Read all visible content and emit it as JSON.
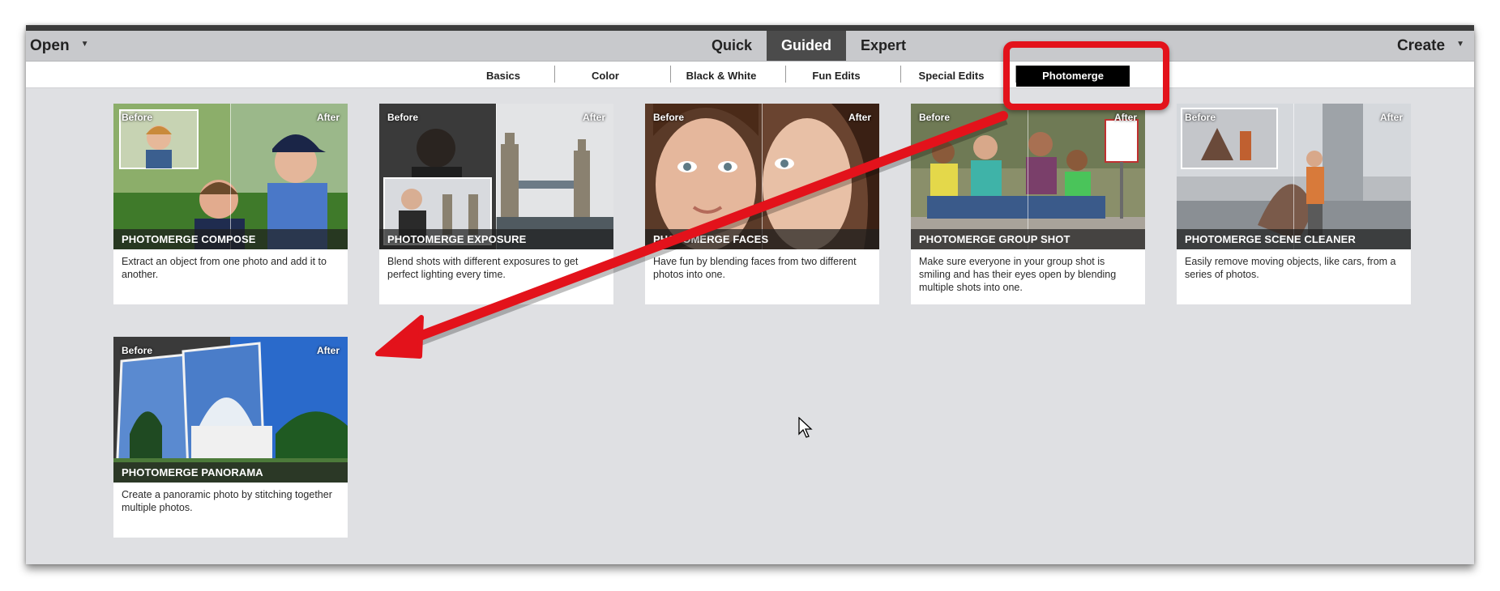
{
  "header": {
    "open_label": "Open",
    "create_label": "Create",
    "modes": [
      "Quick",
      "Guided",
      "Expert"
    ],
    "active_mode": "Guided"
  },
  "categories": {
    "tabs": [
      "Basics",
      "Color",
      "Black & White",
      "Fun Edits",
      "Special Edits",
      "Photomerge"
    ],
    "active": "Photomerge"
  },
  "cards": [
    {
      "title": "PHOTOMERGE COMPOSE",
      "before": "Before",
      "after": "After",
      "description": "Extract an object from one photo and add it to another."
    },
    {
      "title": "PHOTOMERGE EXPOSURE",
      "before": "Before",
      "after": "After",
      "description": "Blend shots with different exposures to get perfect lighting every time."
    },
    {
      "title": "PHOTOMERGE FACES",
      "before": "Before",
      "after": "After",
      "description": "Have fun by blending faces from two different photos into one."
    },
    {
      "title": "PHOTOMERGE GROUP SHOT",
      "before": "Before",
      "after": "After",
      "description": "Make sure everyone in your group shot is smiling and has their eyes open by blending multiple shots into one."
    },
    {
      "title": "PHOTOMERGE SCENE CLEANER",
      "before": "Before",
      "after": "After",
      "description": "Easily remove moving objects, like cars, from a series of photos."
    },
    {
      "title": "PHOTOMERGE PANORAMA",
      "before": "Before",
      "after": "After",
      "description": "Create a panoramic photo by stitching together multiple photos."
    }
  ],
  "colors": {
    "annotation_red": "#e3121b",
    "active_tab_bg": "#000000",
    "active_mode_bg": "#4b4b4b"
  }
}
